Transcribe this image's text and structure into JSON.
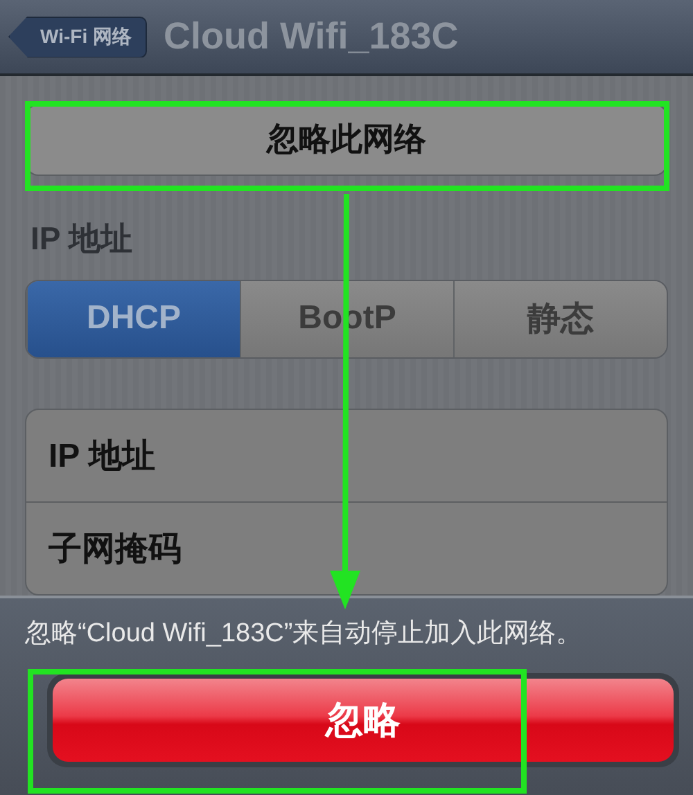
{
  "nav_bar": {
    "back_button": "Wi-Fi 网络",
    "title": "Cloud Wifi_183C"
  },
  "forget_button": "忽略此网络",
  "ip_section": {
    "header": "IP 地址",
    "segments": [
      {
        "label": "DHCP",
        "selected": true
      },
      {
        "label": "BootP",
        "selected": false
      },
      {
        "label": "静态",
        "selected": false
      }
    ],
    "rows": [
      {
        "label": "IP 地址"
      },
      {
        "label": "子网掩码"
      }
    ]
  },
  "action_sheet": {
    "message": "忽略“Cloud Wifi_183C”来自动停止加入此网络。",
    "button": "忽略"
  },
  "annotations": [
    {
      "kind": "frame"
    },
    {
      "kind": "arrow"
    },
    {
      "kind": "frame"
    }
  ]
}
